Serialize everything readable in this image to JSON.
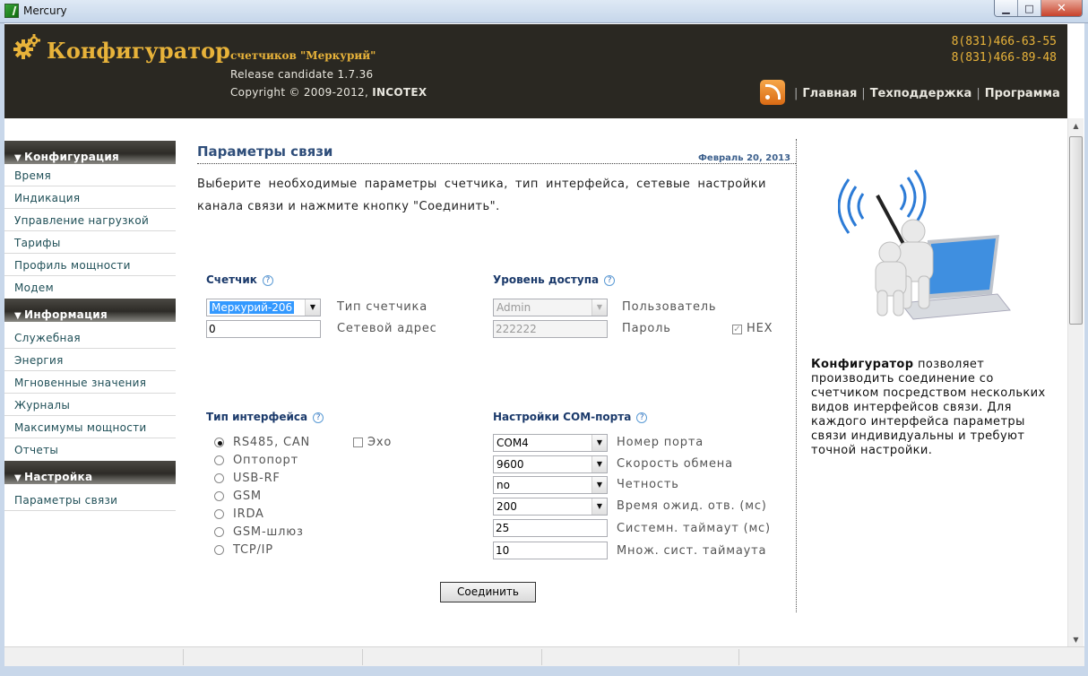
{
  "window": {
    "title": "Mercury",
    "minimize": "▁",
    "maximize": "□",
    "close": "✕"
  },
  "header": {
    "brand": "Конфигуратор",
    "brand_sub": "счетчиков \"Меркурий\"",
    "release": "Release candidate 1.7.36",
    "copyright_prefix": "Copyright © 2009-2012, ",
    "copyright_company": "INCOTEX",
    "phone1": "8(831)466-63-55",
    "phone2": "8(831)466-89-48",
    "nav": [
      "Главная",
      "Техподдержка",
      "Программа"
    ],
    "nav_sep": "|",
    "icons": {
      "logo": "gear-icon",
      "feed": "rss-icon"
    },
    "colors": {
      "brand": "#e8b33a",
      "background": "#2a2822"
    }
  },
  "sidebar": {
    "sections": [
      {
        "title": "Конфигурация",
        "items": [
          "Время",
          "Индикация",
          "Управление нагрузкой",
          "Тарифы",
          "Профиль мощности",
          "Модем"
        ]
      },
      {
        "title": "Информация",
        "items": [
          "Служебная",
          "Энергия",
          "Мгновенные значения",
          "Журналы",
          "Максимумы мощности",
          "Отчеты"
        ]
      },
      {
        "title": "Настройка",
        "items": [
          "Параметры связи"
        ]
      }
    ],
    "expand_glyph": "▼"
  },
  "main": {
    "title": "Параметры связи",
    "date": "Февраль 20, 2013",
    "intro": "Выберите необходимые параметры счетчика, тип интерфейса, сетевые настройки канала связи и нажмите кнопку \"Соединить\".",
    "help_glyph": "?",
    "meter": {
      "title": "Счетчик",
      "type_value": "Меркурий-206",
      "type_label": "Тип счетчика",
      "address_value": "0",
      "address_label": "Сетевой адрес"
    },
    "access": {
      "title": "Уровень доступа",
      "user_value": "Admin",
      "user_label": "Пользователь",
      "password_value": "222222",
      "password_label": "Пароль",
      "hex_label": "HEX",
      "hex_checked": true
    },
    "interface": {
      "title": "Тип интерфейса",
      "options": [
        "RS485, CAN",
        "Оптопорт",
        "USB-RF",
        "GSM",
        "IRDA",
        "GSM-шлюз",
        "TCP/IP"
      ],
      "selected": "RS485, CAN",
      "echo_label": "Эхо",
      "echo_checked": false
    },
    "com": {
      "title": "Настройки COM-порта",
      "port_value": "COM4",
      "port_label": "Номер порта",
      "speed_value": "9600",
      "speed_label": "Скорость обмена",
      "parity_value": "no",
      "parity_label": "Четность",
      "wait_value": "200",
      "wait_label": "Время ожид. отв. (мс)",
      "timeout_value": "25",
      "timeout_label": "Системн. таймаут (мс)",
      "mult_value": "10",
      "mult_label": "Множ. сист. таймаута"
    },
    "connect_button": "Соединить"
  },
  "aside": {
    "brand": "Конфигуратор",
    "text": " позволяет производить соединение со счетчиком посредством нескольких видов интерфейсов связи. Для каждого интерфейса параметры связи индивидуальны и требуют точной настройки.",
    "image": "network-laptop-illustration"
  }
}
